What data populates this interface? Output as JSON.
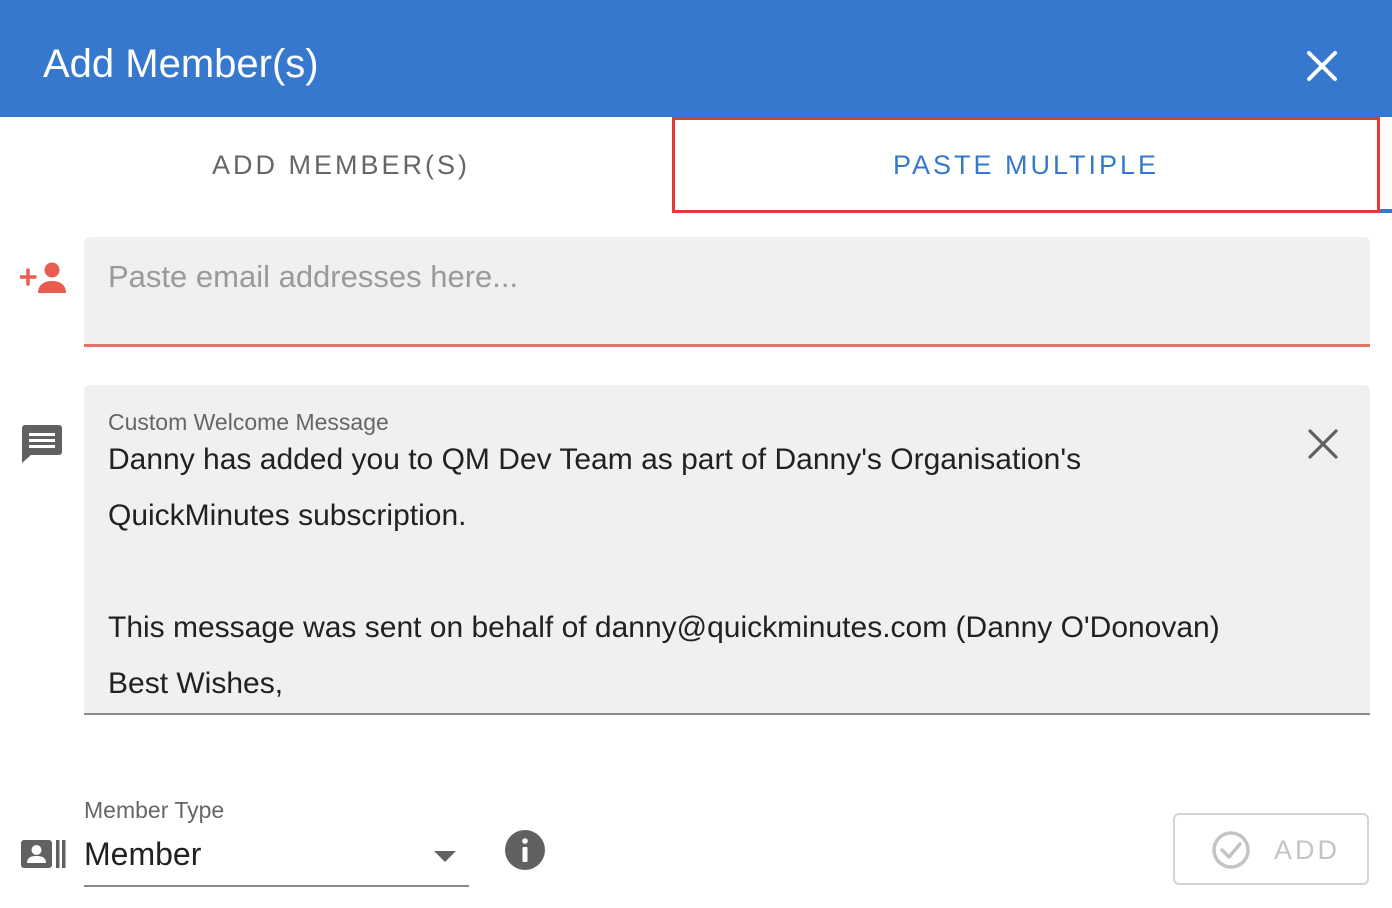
{
  "dialog": {
    "title": "Add Member(s)",
    "close_icon": "close-icon"
  },
  "tabs": [
    {
      "label": "ADD MEMBER(S)",
      "active": false
    },
    {
      "label": "PASTE MULTIPLE",
      "active": true
    }
  ],
  "email_input": {
    "icon": "person-add-icon",
    "placeholder": "Paste email addresses here...",
    "value": ""
  },
  "welcome_message": {
    "icon": "message-icon",
    "label": "Custom Welcome Message",
    "lines": [
      "Danny has added you to QM Dev Team as part of Danny's Organisation's",
      "QuickMinutes subscription.",
      "",
      "This message was sent on behalf of danny@quickminutes.com (Danny O'Donovan)",
      "Best Wishes,"
    ],
    "clear_icon": "close-icon"
  },
  "member_type": {
    "icon": "contact-card-icon",
    "label": "Member Type",
    "value": "Member",
    "dropdown_icon": "caret-down-icon",
    "info_icon": "info-icon"
  },
  "add_button": {
    "label": "ADD",
    "icon": "check-circle-icon",
    "disabled": true
  },
  "colors": {
    "header": "#3578cd",
    "accent_red": "#e57368",
    "highlight_box": "#e53935"
  }
}
